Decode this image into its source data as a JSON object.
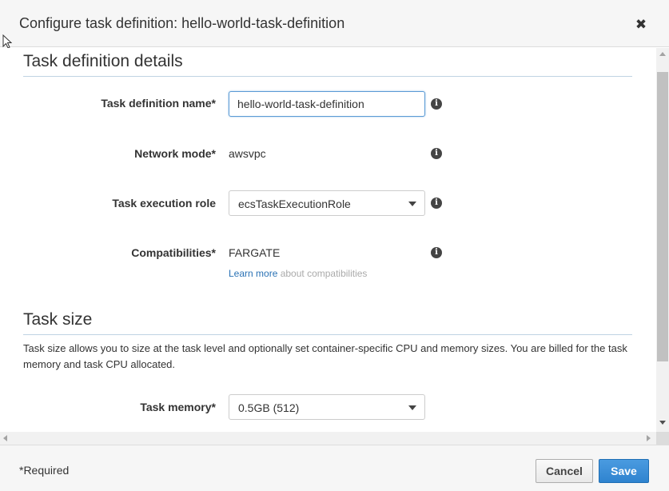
{
  "dialog": {
    "title": "Configure task definition: hello-world-task-definition",
    "close_symbol": "✖"
  },
  "details_section": {
    "title": "Task definition details",
    "task_definition_name": {
      "label": "Task definition name*",
      "value": "hello-world-task-definition"
    },
    "network_mode": {
      "label": "Network mode*",
      "value": "awsvpc"
    },
    "task_execution_role": {
      "label": "Task execution role",
      "selected": "ecsTaskExecutionRole"
    },
    "compatibilities": {
      "label": "Compatibilities*",
      "value": "FARGATE",
      "learn_more_link": "Learn more",
      "learn_more_rest": " about compatibilities"
    },
    "info_symbol": "i"
  },
  "size_section": {
    "title": "Task size",
    "description": "Task size allows you to size at the task level and optionally set container-specific CPU and memory sizes. You are billed for the task memory and task CPU allocated.",
    "task_memory": {
      "label": "Task memory*",
      "selected": "0.5GB (512)"
    }
  },
  "footer": {
    "required_note": "*Required",
    "cancel_label": "Cancel",
    "save_label": "Save"
  },
  "colors": {
    "accent": "#2f83cf",
    "link": "#2a72b5",
    "header_bg": "#f6f6f6"
  }
}
